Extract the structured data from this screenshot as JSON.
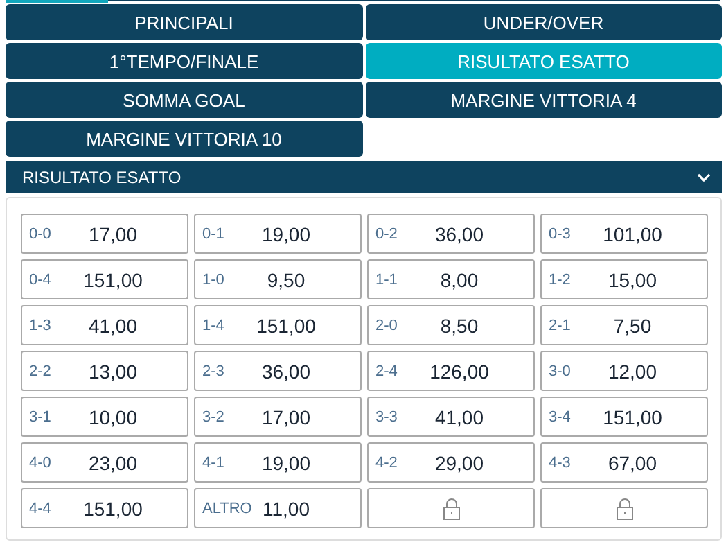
{
  "markets": [
    {
      "label": "PRINCIPALI",
      "selected": false
    },
    {
      "label": "UNDER/OVER",
      "selected": false
    },
    {
      "label": "1°TEMPO/FINALE",
      "selected": false
    },
    {
      "label": "RISULTATO ESATTO",
      "selected": true
    },
    {
      "label": "SOMMA GOAL",
      "selected": false
    },
    {
      "label": "MARGINE VITTORIA 4",
      "selected": false
    },
    {
      "label": "MARGINE VITTORIA 10",
      "selected": false
    }
  ],
  "section": {
    "title": "RISULTATO ESATTO",
    "expanded": true
  },
  "odds": [
    {
      "kind": "odd",
      "score": "0-0",
      "price": "17,00"
    },
    {
      "kind": "odd",
      "score": "0-1",
      "price": "19,00"
    },
    {
      "kind": "odd",
      "score": "0-2",
      "price": "36,00"
    },
    {
      "kind": "odd",
      "score": "0-3",
      "price": "101,00"
    },
    {
      "kind": "odd",
      "score": "0-4",
      "price": "151,00"
    },
    {
      "kind": "odd",
      "score": "1-0",
      "price": "9,50"
    },
    {
      "kind": "odd",
      "score": "1-1",
      "price": "8,00"
    },
    {
      "kind": "odd",
      "score": "1-2",
      "price": "15,00"
    },
    {
      "kind": "odd",
      "score": "1-3",
      "price": "41,00"
    },
    {
      "kind": "odd",
      "score": "1-4",
      "price": "151,00"
    },
    {
      "kind": "odd",
      "score": "2-0",
      "price": "8,50"
    },
    {
      "kind": "odd",
      "score": "2-1",
      "price": "7,50"
    },
    {
      "kind": "odd",
      "score": "2-2",
      "price": "13,00"
    },
    {
      "kind": "odd",
      "score": "2-3",
      "price": "36,00"
    },
    {
      "kind": "odd",
      "score": "2-4",
      "price": "126,00"
    },
    {
      "kind": "odd",
      "score": "3-0",
      "price": "12,00"
    },
    {
      "kind": "odd",
      "score": "3-1",
      "price": "10,00"
    },
    {
      "kind": "odd",
      "score": "3-2",
      "price": "17,00"
    },
    {
      "kind": "odd",
      "score": "3-3",
      "price": "41,00"
    },
    {
      "kind": "odd",
      "score": "3-4",
      "price": "151,00"
    },
    {
      "kind": "odd",
      "score": "4-0",
      "price": "23,00"
    },
    {
      "kind": "odd",
      "score": "4-1",
      "price": "19,00"
    },
    {
      "kind": "odd",
      "score": "4-2",
      "price": "29,00"
    },
    {
      "kind": "odd",
      "score": "4-3",
      "price": "67,00"
    },
    {
      "kind": "odd",
      "score": "4-4",
      "price": "151,00"
    },
    {
      "kind": "odd",
      "score": "ALTRO",
      "price": "11,00"
    },
    {
      "kind": "locked"
    },
    {
      "kind": "locked"
    }
  ]
}
